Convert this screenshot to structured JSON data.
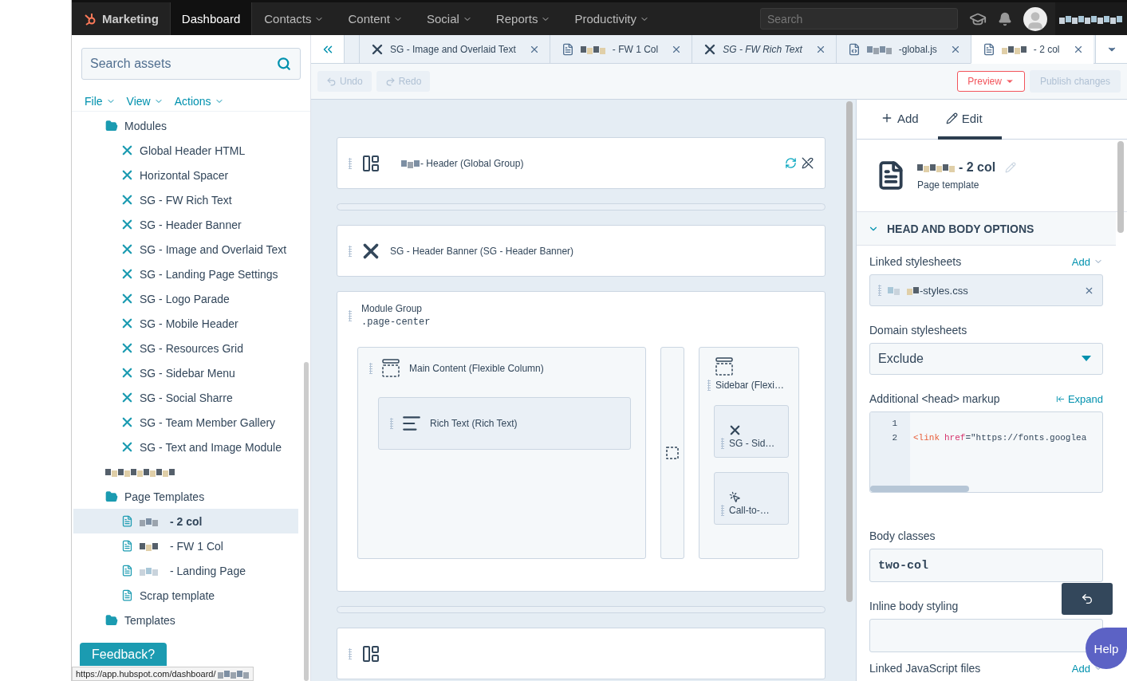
{
  "nav": {
    "brand": "Marketing",
    "items": [
      {
        "label": "Dashboard",
        "selected": true,
        "dropdown": false
      },
      {
        "label": "Contacts",
        "selected": false,
        "dropdown": true
      },
      {
        "label": "Content",
        "selected": false,
        "dropdown": true
      },
      {
        "label": "Social",
        "selected": false,
        "dropdown": true
      },
      {
        "label": "Reports",
        "selected": false,
        "dropdown": true
      },
      {
        "label": "Productivity",
        "selected": false,
        "dropdown": true
      }
    ],
    "search_placeholder": "Search"
  },
  "sidebar": {
    "search_placeholder": "Search assets",
    "menus": [
      "File",
      "View",
      "Actions"
    ],
    "tree": [
      {
        "label": "Modules",
        "kind": "folder",
        "children": [
          {
            "label": "Global Header HTML",
            "kind": "module",
            "selected": false
          },
          {
            "label": "Horizontal Spacer",
            "kind": "module",
            "selected": false
          },
          {
            "label": "SG - FW Rich Text",
            "kind": "module",
            "selected": false
          },
          {
            "label": "SG - Header Banner",
            "kind": "module",
            "selected": false
          },
          {
            "label": "SG - Image and Overlaid Text",
            "kind": "module",
            "selected": false
          },
          {
            "label": "SG - Landing Page Settings",
            "kind": "module",
            "selected": false
          },
          {
            "label": "SG - Logo Parade",
            "kind": "module",
            "selected": false
          },
          {
            "label": "SG - Mobile Header",
            "kind": "module",
            "selected": false
          },
          {
            "label": "SG - Resources Grid",
            "kind": "module",
            "selected": false
          },
          {
            "label": "SG - Sidebar Menu",
            "kind": "module",
            "selected": false
          },
          {
            "label": "SG - Social Sharre",
            "kind": "module",
            "selected": false
          },
          {
            "label": "SG - Team Member Gallery",
            "kind": "module",
            "selected": false
          },
          {
            "label": "SG - Text and Image Module",
            "kind": "module",
            "selected": false
          },
          {
            "kind": "pixelated",
            "selected": false
          }
        ]
      },
      {
        "label": "Page Templates",
        "kind": "folder",
        "children": [
          {
            "label": "- 2 col",
            "kind": "page",
            "selected": true,
            "pixelated": true
          },
          {
            "label": "- FW 1 Col",
            "kind": "page",
            "selected": false,
            "pixelated": true
          },
          {
            "label": "- Landing Page",
            "kind": "page",
            "selected": false,
            "pixelated": true
          },
          {
            "label": "Scrap template",
            "kind": "page",
            "selected": false,
            "pixelated": false
          }
        ]
      },
      {
        "label": "Templates",
        "kind": "folder"
      }
    ],
    "feedback": "Feedback?"
  },
  "tabs": [
    {
      "label": "SG - Image and Overlaid Text",
      "kind": "module",
      "selected": false,
      "italic": false,
      "pixelated": false
    },
    {
      "label": "- FW 1 Col",
      "kind": "page",
      "selected": false,
      "italic": false,
      "pixelated": true
    },
    {
      "label": "SG - FW Rich Text",
      "kind": "module",
      "selected": false,
      "italic": true,
      "pixelated": false
    },
    {
      "label": "-global.js",
      "kind": "script",
      "selected": false,
      "italic": false,
      "pixelated": true
    },
    {
      "label": "- 2 col",
      "kind": "page",
      "selected": true,
      "italic": false,
      "pixelated": true
    }
  ],
  "toolbar": {
    "left": [
      {
        "label": "Undo",
        "kind": "undo",
        "disabled": true
      },
      {
        "label": "Redo",
        "kind": "redo",
        "disabled": true
      }
    ],
    "preview": "Preview",
    "publish": {
      "label": "Publish changes",
      "disabled": true
    }
  },
  "canvas": {
    "header": {
      "label": "- Header (Global Group)"
    },
    "banner": {
      "label": "SG - Header Banner (SG - Header Banner)"
    },
    "group": {
      "title": "Module Group",
      "class_name": ".page-center",
      "main": {
        "label": "Main Content (Flexible Column)",
        "modules": [
          {
            "label": "Rich Text (Rich Text)",
            "kind": "text"
          }
        ]
      },
      "side": {
        "label": "Sidebar (Flexi…",
        "modules": [
          {
            "label": "SG - Sid…",
            "kind": "module"
          },
          {
            "label": "Call-to-…",
            "kind": "cta"
          }
        ]
      }
    }
  },
  "panel": {
    "tabs": [
      {
        "label": "Add",
        "kind": "add",
        "selected": false
      },
      {
        "label": "Edit",
        "kind": "edit",
        "selected": true
      }
    ],
    "template": {
      "name": "- 2 col",
      "type": "Page template"
    },
    "section": {
      "title": "HEAD AND BODY OPTIONS",
      "expanded": true
    },
    "linked_stylesheets": {
      "label": "Linked stylesheets",
      "action": "Add",
      "files": [
        "-styles.css"
      ]
    },
    "domain_stylesheets": {
      "label": "Domain stylesheets",
      "value": "Exclude"
    },
    "head_markup": {
      "label": "Additional <head> markup",
      "action": "Expand",
      "lines": [
        {
          "number": "1"
        },
        {
          "number": "2",
          "tokens": [
            {
              "text": "<link",
              "kind": "tag"
            },
            {
              "text": "href",
              "kind": "attr"
            },
            {
              "text": "=\"https://fonts.googlea",
              "kind": "plain"
            }
          ]
        }
      ]
    },
    "body_classes": {
      "label": "Body classes",
      "value": "two-col"
    },
    "inline_styling": {
      "label": "Inline body styling"
    },
    "linked_js": {
      "label": "Linked JavaScript files",
      "action": "Add"
    },
    "help": "Help"
  },
  "status_bar": "https://app.hubspot.com/dashboard/"
}
